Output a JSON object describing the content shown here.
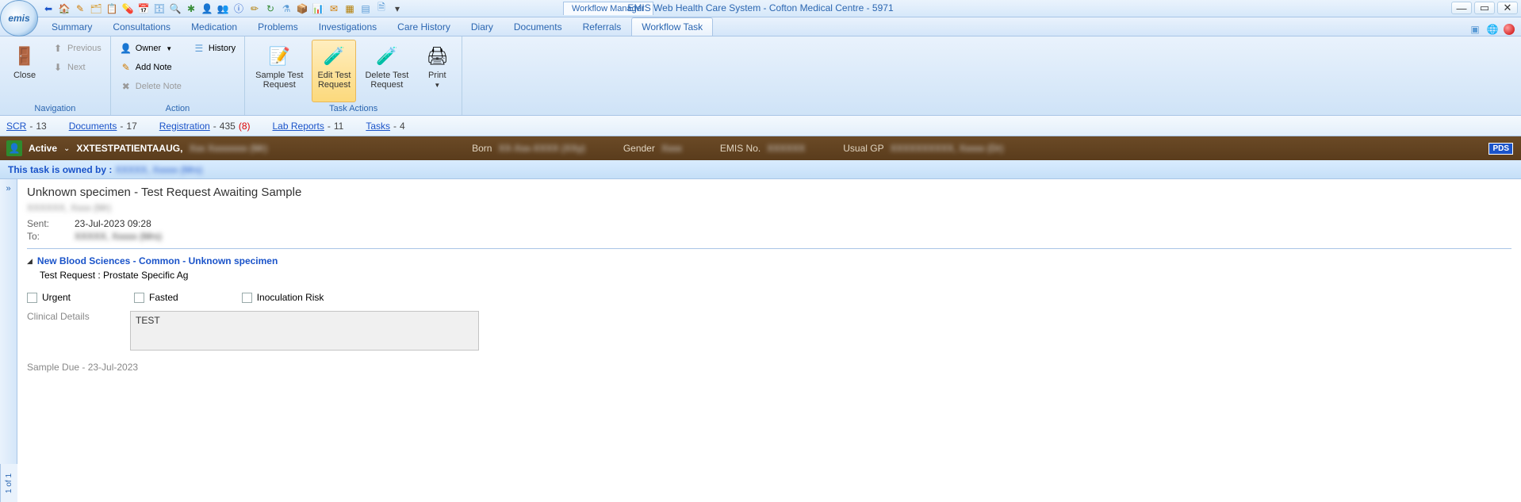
{
  "window": {
    "title": "EMIS Web Health Care System - Cofton Medical Centre - 5971",
    "module_tab": "Workflow Manager"
  },
  "menu_tabs": [
    "Summary",
    "Consultations",
    "Medication",
    "Problems",
    "Investigations",
    "Care History",
    "Diary",
    "Documents",
    "Referrals",
    "Workflow Task"
  ],
  "active_menu_tab": "Workflow Task",
  "ribbon": {
    "navigation": {
      "label": "Navigation",
      "close": "Close",
      "previous": "Previous",
      "next": "Next"
    },
    "action": {
      "label": "Action",
      "owner": "Owner",
      "history": "History",
      "add_note": "Add Note",
      "delete_note": "Delete Note"
    },
    "task_actions": {
      "label": "Task Actions",
      "sample": "Sample Test\nRequest",
      "edit": "Edit Test\nRequest",
      "delete": "Delete Test\nRequest",
      "print": "Print"
    }
  },
  "counts": {
    "scr": {
      "label": "SCR",
      "count": "13"
    },
    "documents": {
      "label": "Documents",
      "count": "17"
    },
    "registration": {
      "label": "Registration",
      "count": "435",
      "paren": "(8)"
    },
    "lab": {
      "label": "Lab Reports",
      "count": "11"
    },
    "tasks": {
      "label": "Tasks",
      "count": "4"
    }
  },
  "patient": {
    "status": "Active",
    "name": "XXTESTPATIENTAAUG,",
    "name_rest": "Xxx Xxxxxxxx (Mr)",
    "born_label": "Born",
    "born_value": "XX-Xxx-XXXX (XXy)",
    "gender_label": "Gender",
    "gender_value": "Xxxx",
    "emis_label": "EMIS No.",
    "emis_value": "XXXXXX",
    "gp_label": "Usual GP",
    "gp_value": "XXXXXXXXXX, Xxxxx (Dr)",
    "pds": "PDS"
  },
  "task_owner": {
    "prefix": "This task is owned by :",
    "name": "XXXXX, Xxxxx (Mrs)"
  },
  "task": {
    "title": "Unknown specimen - Test Request Awaiting Sample",
    "from": "XXXXXX, Xxxx (Mr)",
    "sent_label": "Sent:",
    "sent_value": "23-Jul-2023 09:28",
    "to_label": "To:",
    "to_value": "XXXXX, Xxxxx (Mrs)",
    "section_link": "New Blood Sciences - Common - Unknown specimen",
    "test_request": "Test Request : Prostate Specific Ag",
    "urgent": "Urgent",
    "fasted": "Fasted",
    "inoculation": "Inoculation Risk",
    "clinical_label": "Clinical Details",
    "clinical_value": "TEST",
    "sample_due": "Sample Due - 23-Jul-2023"
  },
  "page_indicator": "1 of 1"
}
